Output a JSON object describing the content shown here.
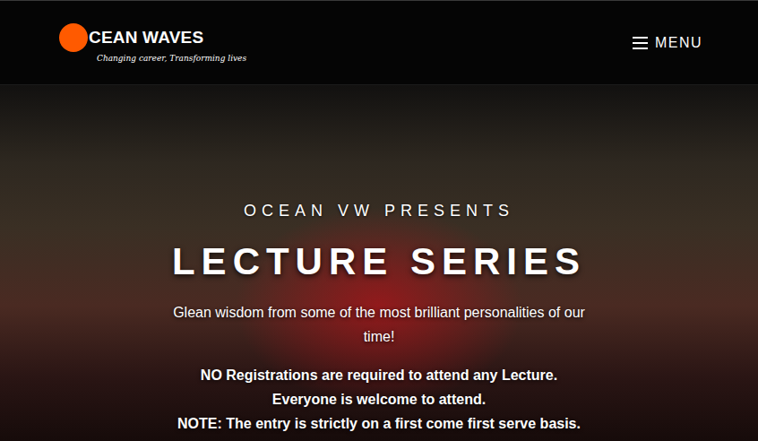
{
  "header": {
    "logo": {
      "text": "CEAN WAVES",
      "tagline": "Changing career, Transforming lives"
    },
    "menu": {
      "label": "MENU"
    }
  },
  "hero": {
    "eyebrow": "OCEAN VW PRESENTS",
    "title": "LECTURE SERIES",
    "subtitle": "Glean wisdom from some of the most brilliant personalities of our time!",
    "notes": [
      "NO Registrations are required to attend any Lecture.",
      "Everyone is welcome to attend.",
      "NOTE: The entry is strictly on a first come first serve basis."
    ]
  }
}
